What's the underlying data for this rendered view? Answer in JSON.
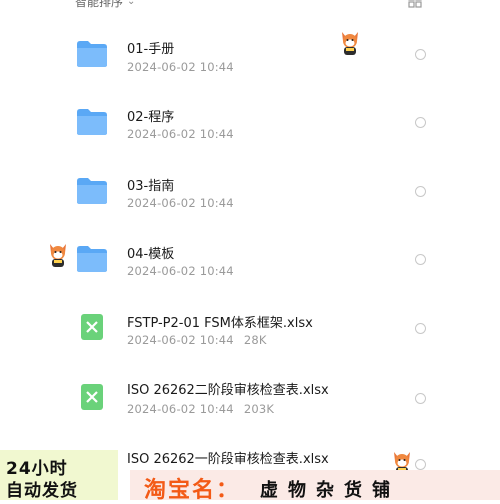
{
  "toolbar": {
    "sort_label": "智能排序",
    "sort_icon": "chevron-down-icon",
    "view_icon": "grid-view-icon"
  },
  "files": [
    {
      "type": "folder",
      "name": "01-手册",
      "date": "2024-06-02 10:44",
      "size": ""
    },
    {
      "type": "folder",
      "name": "02-程序",
      "date": "2024-06-02 10:44",
      "size": ""
    },
    {
      "type": "folder",
      "name": "03-指南",
      "date": "2024-06-02 10:44",
      "size": ""
    },
    {
      "type": "folder",
      "name": "04-模板",
      "date": "2024-06-02 10:44",
      "size": ""
    },
    {
      "type": "xlsx",
      "name": "FSTP-P2-01 FSM体系框架.xlsx",
      "date": "2024-06-02 10:44",
      "size": "28K"
    },
    {
      "type": "xlsx",
      "name": "ISO 26262二阶段审核检查表.xlsx",
      "date": "2024-06-02 10:44",
      "size": "203K"
    },
    {
      "type": "xlsx",
      "name": "ISO 26262一阶段审核检查表.xlsx",
      "date": "",
      "size": ""
    }
  ],
  "promo": {
    "line1": "24小时",
    "line2": "自动发货",
    "shop_key": "淘宝名：",
    "shop_name": "虚物杂货铺"
  },
  "colors": {
    "folder": "#5aa8f5",
    "xlsx": "#6ad27a",
    "promo_orange": "#f35a16"
  }
}
